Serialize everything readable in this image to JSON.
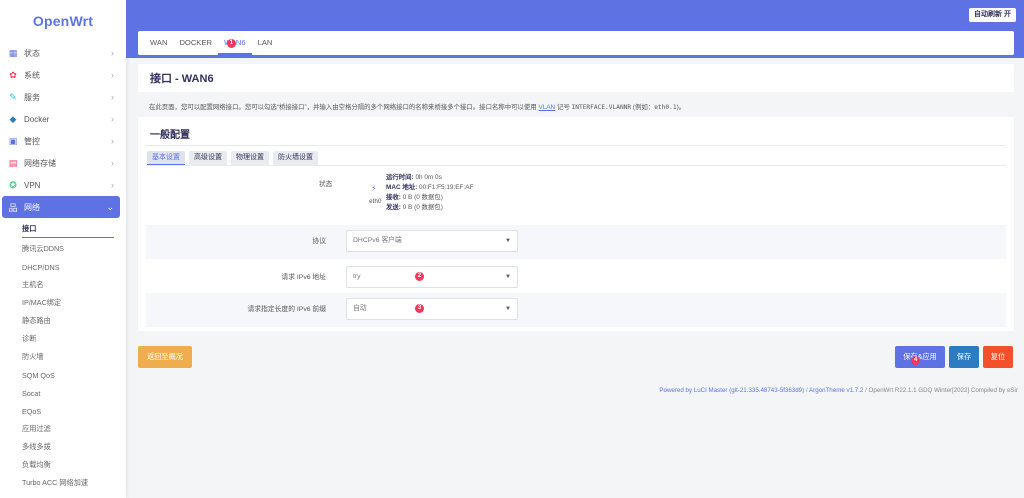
{
  "logo": "OpenWrt",
  "sidebar": {
    "items": [
      {
        "label": "状态",
        "icon": "status-icon",
        "color": "#5e72e4"
      },
      {
        "label": "系统",
        "icon": "gear-icon",
        "color": "#f5365c"
      },
      {
        "label": "服务",
        "icon": "services-icon",
        "color": "#11cdef"
      },
      {
        "label": "Docker",
        "icon": "docker-icon",
        "color": "#2dce89"
      },
      {
        "label": "管控",
        "icon": "control-icon",
        "color": "#5e72e4"
      },
      {
        "label": "网络存储",
        "icon": "storage-icon",
        "color": "#f5365c"
      },
      {
        "label": "VPN",
        "icon": "vpn-icon",
        "color": "#2dce89"
      },
      {
        "label": "网络",
        "icon": "network-icon",
        "color": "#ffffff"
      }
    ],
    "sub_items": [
      "接口",
      "腾讯云DDNS",
      "DHCP/DNS",
      "主机名",
      "IP/MAC绑定",
      "静态路由",
      "诊断",
      "防火墙",
      "SQM QoS",
      "Socat",
      "EQoS",
      "应用过滤",
      "多线多拨",
      "负载均衡",
      "Turbo ACC 网络加速"
    ]
  },
  "header": {
    "refresh_label": "自动刷新 开"
  },
  "tabs": [
    {
      "label": "WAN"
    },
    {
      "label": "DOCKER"
    },
    {
      "label": "WAN6",
      "badge": "1"
    },
    {
      "label": "LAN"
    }
  ],
  "page": {
    "title": "接口 - WAN6",
    "desc_part1": "在此页面，您可以配置网络接口。您可以勾选“桥接接口”，并输入由空格分隔的多个网络接口的名称来桥接多个接口。接口名称中可以使用 ",
    "desc_vlan": "VLAN",
    "desc_part2": " 记号 ",
    "desc_code1": "INTERFACE.VLANNR",
    "desc_part3": " (例如：",
    "desc_code2": "eth0.1",
    "desc_part4": ")。"
  },
  "config": {
    "title": "一般配置",
    "subtabs": [
      "基本设置",
      "高级设置",
      "物理设置",
      "防火墙设置"
    ],
    "status_label": "状态",
    "device": "eth0",
    "status": {
      "uptime_label": "运行时间:",
      "uptime": "0h 0m 0s",
      "mac_label": "MAC 地址:",
      "mac": "00:F1:F5:19:EF:AF",
      "rx_label": "接收:",
      "rx": "0 B (0 数据包)",
      "tx_label": "发送:",
      "tx": "0 B (0 数据包)"
    },
    "rows": [
      {
        "label": "协议",
        "value": "DHCPv6 客户端"
      },
      {
        "label": "请求 IPv6 地址",
        "value": "try",
        "badge": "2"
      },
      {
        "label": "请求指定长度的 IPv6 前缀",
        "value": "自动",
        "badge": "3"
      }
    ]
  },
  "buttons": {
    "back": "返回至概况",
    "apply": "保存&应用",
    "apply_badge": "4",
    "save": "保存",
    "reset": "复位"
  },
  "footer": {
    "luci": "Powered by LuCI Master (git-21.335.48743-5f363d9)",
    "sep1": " / ",
    "theme": "ArgonTheme v1.7.2",
    "rest": " / OpenWrt R22.1.1 GDQ Winter[2022] Compiled by eSir"
  }
}
